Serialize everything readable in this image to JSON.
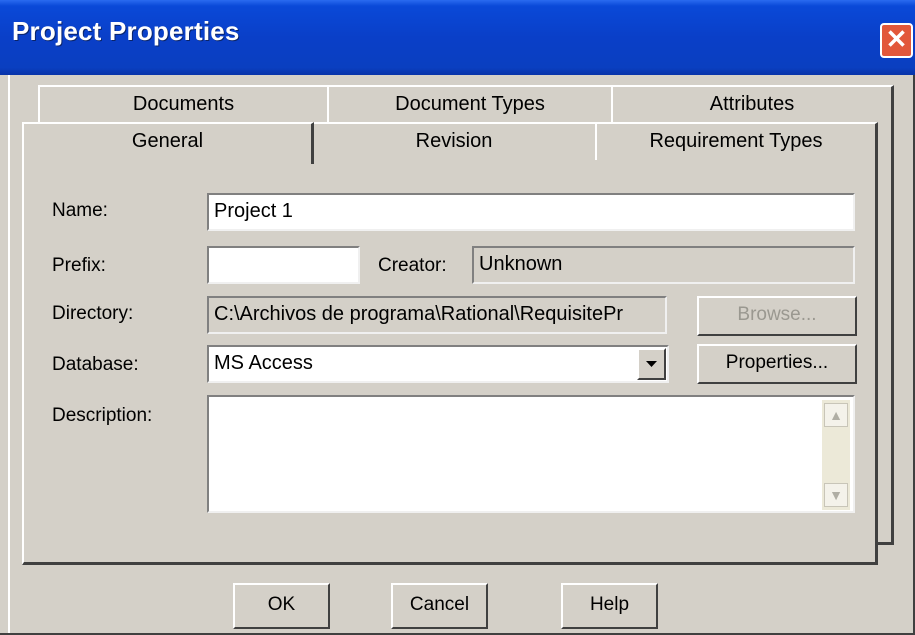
{
  "window": {
    "title": "Project Properties",
    "close_glyph": "✕"
  },
  "tabs": {
    "back_row": [
      {
        "label": "Documents"
      },
      {
        "label": "Document Types"
      },
      {
        "label": "Attributes"
      }
    ],
    "front_row": [
      {
        "label": "General",
        "selected": true
      },
      {
        "label": "Revision"
      },
      {
        "label": "Requirement Types"
      }
    ]
  },
  "form": {
    "name_label": "Name:",
    "name_value": "Project 1",
    "prefix_label": "Prefix:",
    "prefix_value": "",
    "creator_label": "Creator:",
    "creator_value": "Unknown",
    "directory_label": "Directory:",
    "directory_value": "C:\\Archivos de programa\\Rational\\RequisitePr",
    "browse_label": "Browse...",
    "database_label": "Database:",
    "database_value": "MS Access",
    "properties_label": "Properties...",
    "description_label": "Description:",
    "description_value": ""
  },
  "footer": {
    "ok_label": "OK",
    "cancel_label": "Cancel",
    "help_label": "Help"
  },
  "icons": {
    "close": "close-icon",
    "dropdown": "chevron-down-icon",
    "scroll_up": "scroll-up-icon",
    "scroll_down": "scroll-down-icon"
  }
}
